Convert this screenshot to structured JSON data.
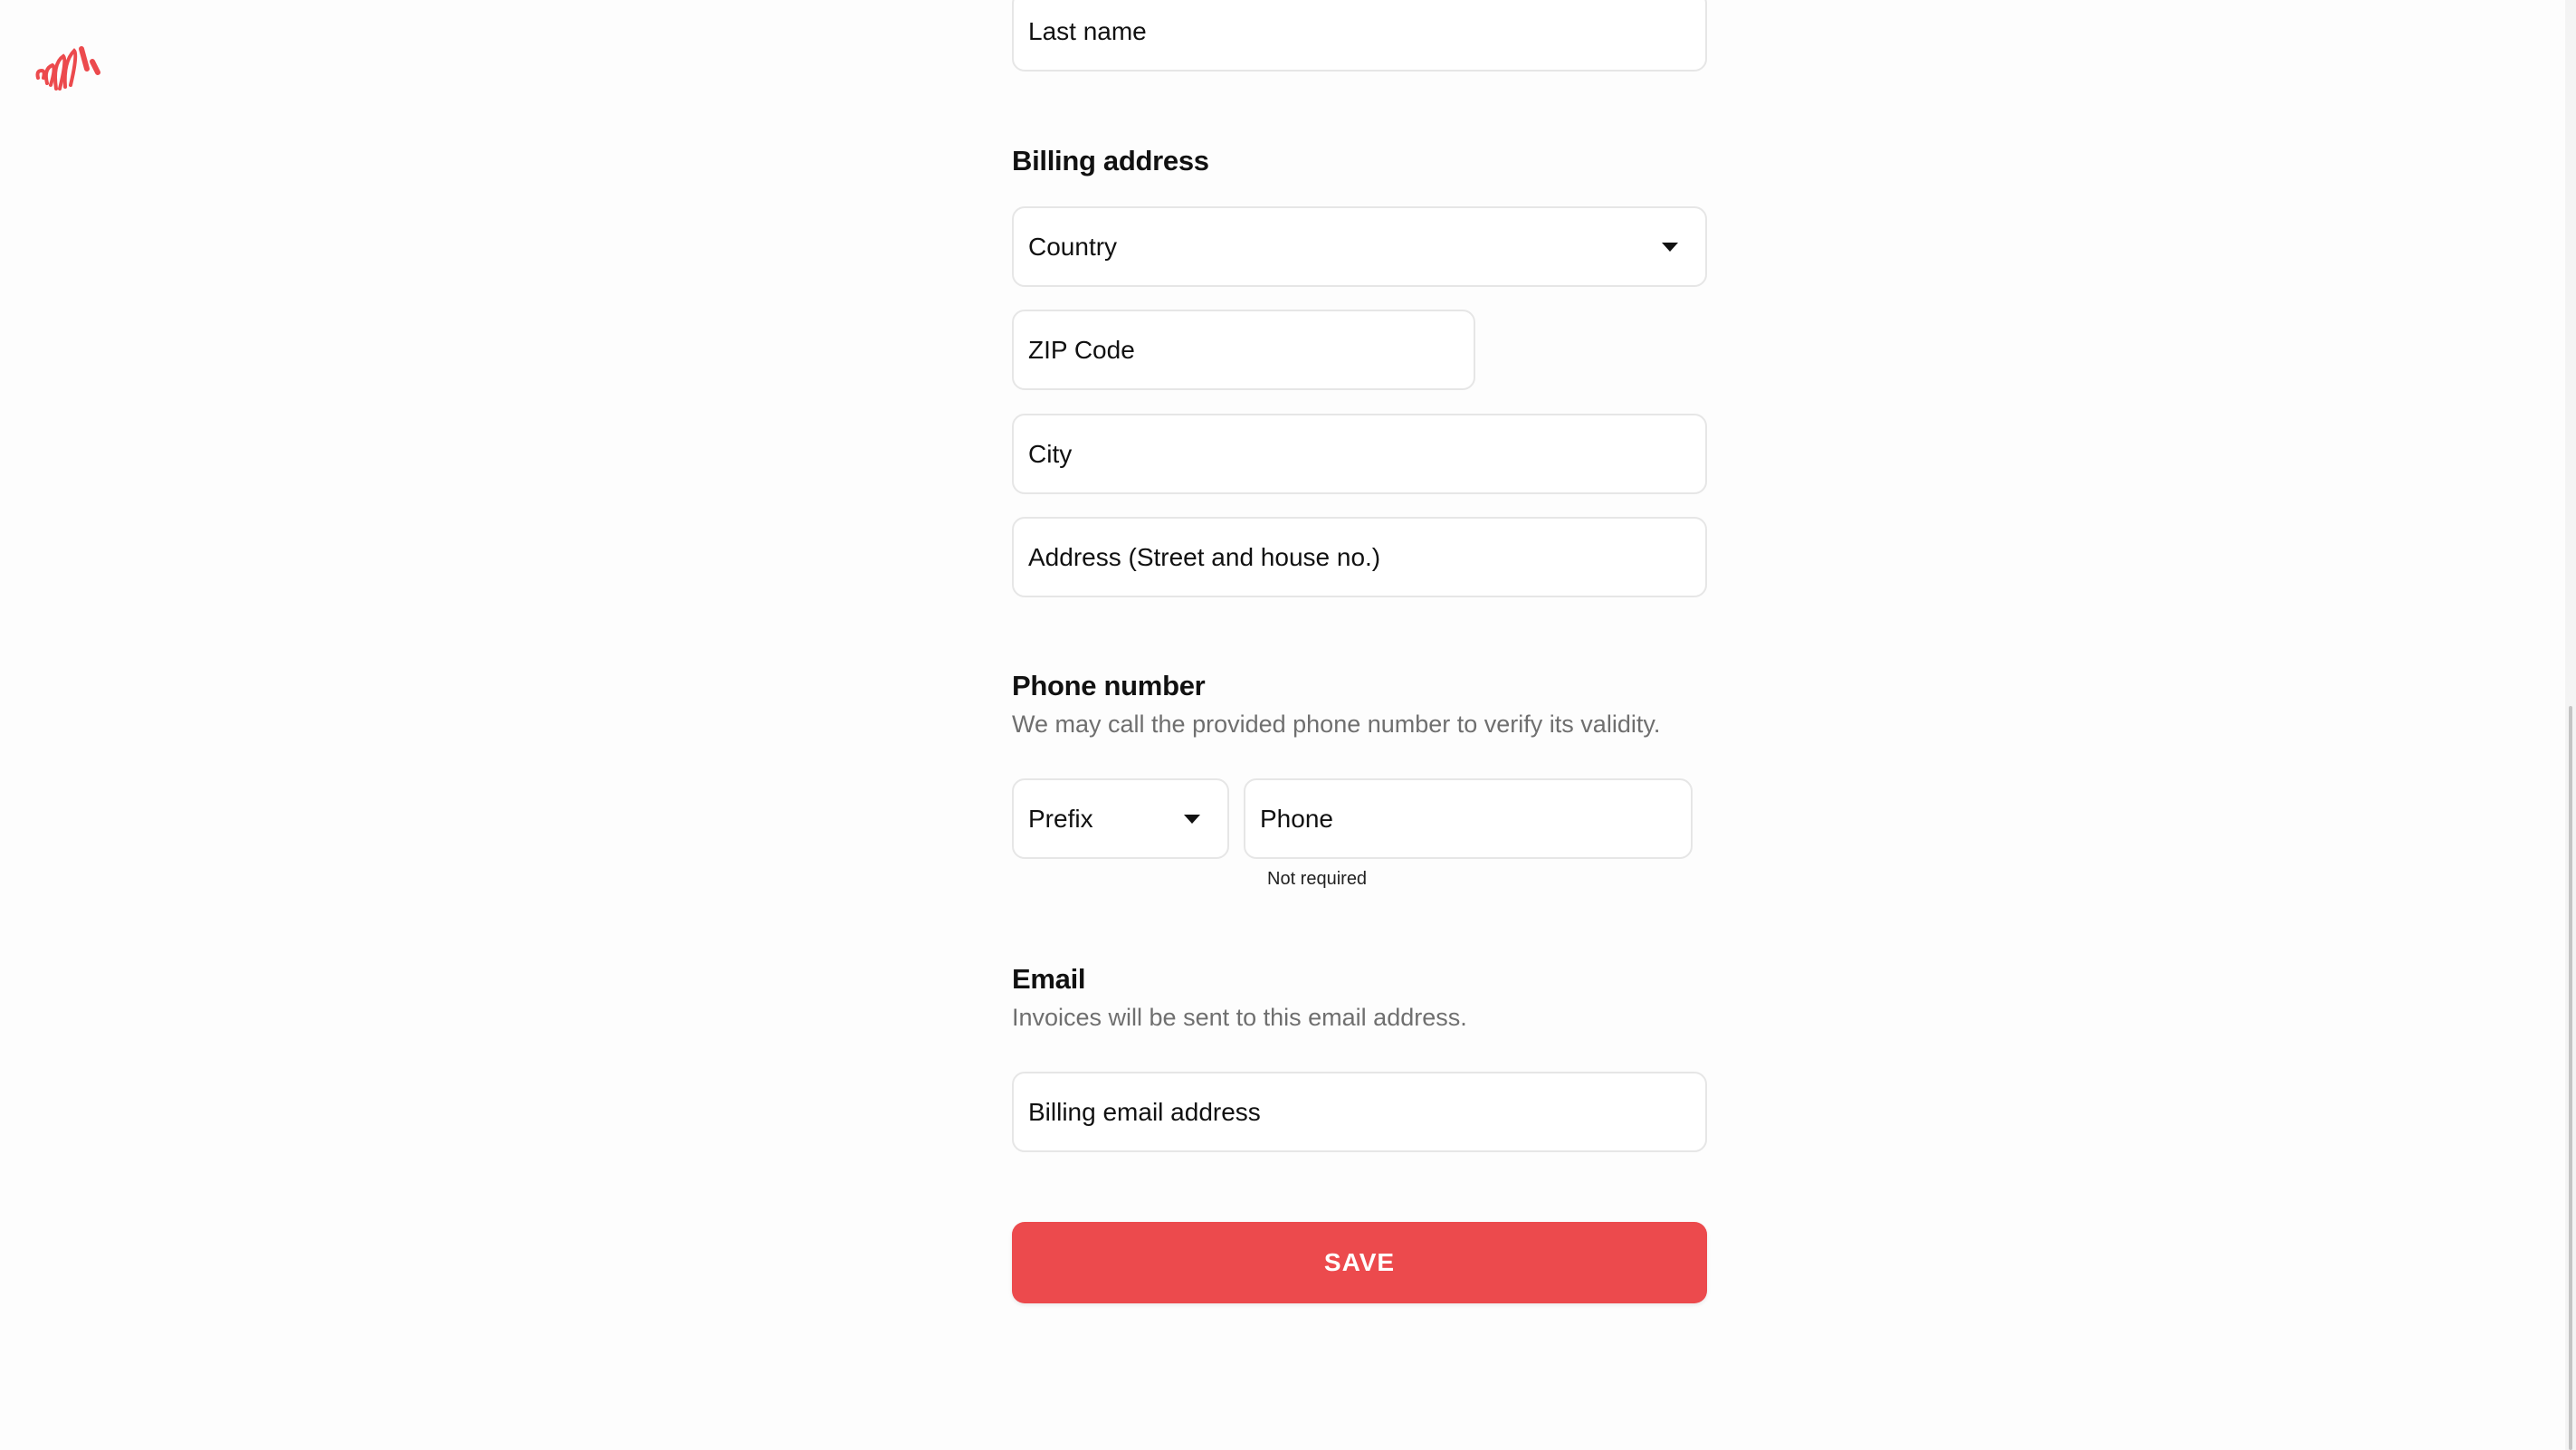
{
  "logo": {
    "name": "brand-logo",
    "color": "#ec4a4d"
  },
  "fields": {
    "last_name": {
      "placeholder": "Last name"
    },
    "country": {
      "placeholder": "Country",
      "icon": "caret-down-icon"
    },
    "zip": {
      "placeholder": "ZIP Code"
    },
    "city": {
      "placeholder": "City"
    },
    "address": {
      "placeholder": "Address (Street and house no.)"
    },
    "prefix": {
      "placeholder": "Prefix",
      "icon": "caret-down-icon"
    },
    "phone": {
      "placeholder": "Phone",
      "hint": "Not required"
    },
    "email": {
      "placeholder": "Billing email address"
    }
  },
  "sections": {
    "billing": {
      "title": "Billing address"
    },
    "phone": {
      "title": "Phone number",
      "description": "We may call the provided phone number to verify its validity."
    },
    "email": {
      "title": "Email",
      "description": "Invoices will be sent to this email address."
    }
  },
  "actions": {
    "save_label": "SAVE"
  },
  "colors": {
    "accent": "#ec4a4d",
    "field_border": "#e6e6e6",
    "muted_text": "#6f6f6f"
  }
}
